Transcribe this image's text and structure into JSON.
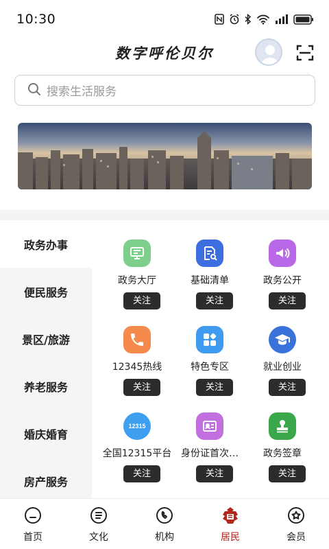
{
  "status_bar": {
    "time": "10:30",
    "icons": [
      "nfc-icon",
      "alarm-icon",
      "bluetooth-icon",
      "wifi-icon",
      "signal-icon",
      "battery-icon"
    ]
  },
  "header": {
    "title": "数字呼伦贝尔",
    "avatar_icon": "avatar-icon",
    "scan_icon": "scan-icon"
  },
  "search": {
    "placeholder": "搜索生活服务"
  },
  "banner": {
    "image": "city-skyline-photo"
  },
  "sidebar": {
    "items": [
      {
        "label": "政务办事",
        "active": true
      },
      {
        "label": "便民服务",
        "active": false
      },
      {
        "label": "景区/旅游",
        "active": false
      },
      {
        "label": "养老服务",
        "active": false
      },
      {
        "label": "婚庆婚育",
        "active": false
      },
      {
        "label": "房产服务",
        "active": false
      }
    ]
  },
  "services": [
    {
      "label": "政务大厅",
      "button": "关注",
      "icon": "monitor-icon",
      "color": "#7ecf8c"
    },
    {
      "label": "基础清单",
      "button": "关注",
      "icon": "document-search-icon",
      "color": "#3d6ee0"
    },
    {
      "label": "政务公开",
      "button": "关注",
      "icon": "megaphone-icon",
      "color": "#b968e8"
    },
    {
      "label": "12345热线",
      "button": "关注",
      "icon": "phone-icon",
      "color": "#f58a4c"
    },
    {
      "label": "特色专区",
      "button": "关注",
      "icon": "apps-icon",
      "color": "#3e9bf0"
    },
    {
      "label": "就业创业",
      "button": "关注",
      "icon": "graduation-cap-icon",
      "color": "#3a72dc"
    },
    {
      "label": "全国12315平台",
      "button": "关注",
      "icon": "12315-badge-icon",
      "icon_text": "12315",
      "color": "#3e9ef0"
    },
    {
      "label": "身份证首次…",
      "button": "关注",
      "icon": "id-card-icon",
      "color": "#c26fe0"
    },
    {
      "label": "政务签章",
      "button": "关注",
      "icon": "stamp-icon",
      "color": "#3aa84a"
    }
  ],
  "bottom_nav": [
    {
      "label": "首页",
      "icon": "home-icon",
      "active": false
    },
    {
      "label": "文化",
      "icon": "culture-icon",
      "active": false
    },
    {
      "label": "机构",
      "icon": "institution-icon",
      "active": false
    },
    {
      "label": "居民",
      "icon": "resident-icon",
      "active": true
    },
    {
      "label": "会员",
      "icon": "member-icon",
      "active": false
    }
  ],
  "colors": {
    "accent": "#b3261e",
    "button_dark": "#2c2c2c",
    "sidebar_bg": "#f5f5f7"
  }
}
